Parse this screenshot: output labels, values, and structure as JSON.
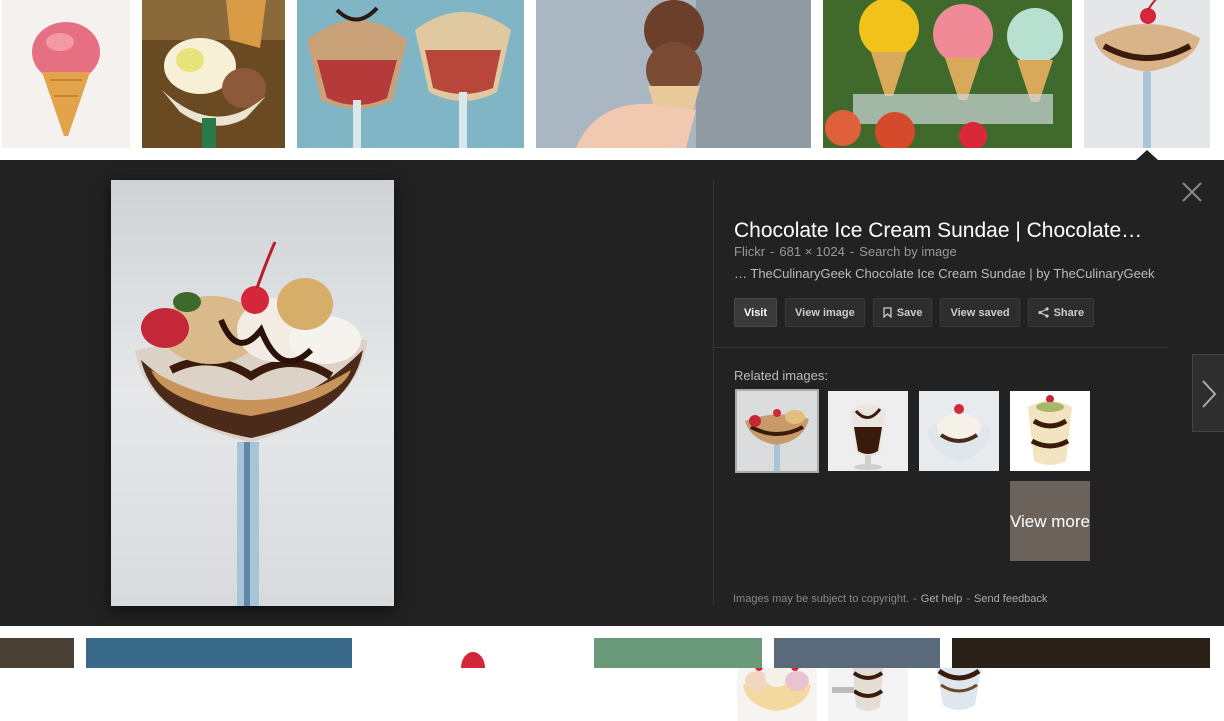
{
  "detail": {
    "title": "Chocolate Ice Cream Sundae | Chocolate…",
    "source": "Flickr",
    "dimensions": "681 × 1024",
    "search_by_image": "Search by image",
    "description": "… TheCulinaryGeek Chocolate Ice Cream Sundae | by TheCulinaryGeek",
    "buttons": {
      "visit": "Visit",
      "view_image": "View image",
      "save": "Save",
      "view_saved": "View saved",
      "share": "Share"
    },
    "related_label": "Related images:",
    "view_more": "View more",
    "footer": {
      "copyright": "Images may be subject to copyright.",
      "get_help": "Get help",
      "send_feedback": "Send feedback"
    }
  },
  "icons": {
    "close": "close-icon",
    "next": "chevron-right-icon",
    "save": "bookmark-icon",
    "share": "share-icon"
  },
  "colors": {
    "panel_bg": "#222222",
    "title": "#ffffff",
    "muted": "#999999"
  }
}
